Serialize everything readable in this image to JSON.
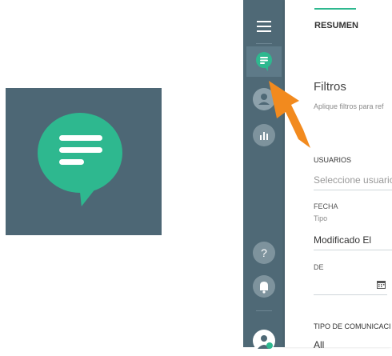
{
  "sidebar": {
    "items": [
      {
        "name": "menu-icon"
      },
      {
        "name": "chat-icon",
        "active": true
      },
      {
        "name": "user-icon"
      },
      {
        "name": "chart-icon"
      },
      {
        "name": "help-icon",
        "label": "?"
      },
      {
        "name": "bell-icon"
      },
      {
        "name": "avatar-icon"
      }
    ]
  },
  "tabs": {
    "active_label": "RESUMEN"
  },
  "filters": {
    "title": "Filtros",
    "subtitle": "Aplique filtros para ref",
    "users": {
      "label": "USUARIOS",
      "placeholder": "Seleccione usuario"
    },
    "date": {
      "label": "FECHA",
      "type_label": "Tipo",
      "type_value": "Modificado El"
    },
    "from": {
      "label": "DE",
      "value": ""
    },
    "comm_type": {
      "label": "TIPO DE COMUNICACI",
      "value": "All"
    }
  },
  "colors": {
    "sidebar": "#4f6976",
    "accent": "#2eb88f",
    "arrow": "#f28a1e"
  }
}
